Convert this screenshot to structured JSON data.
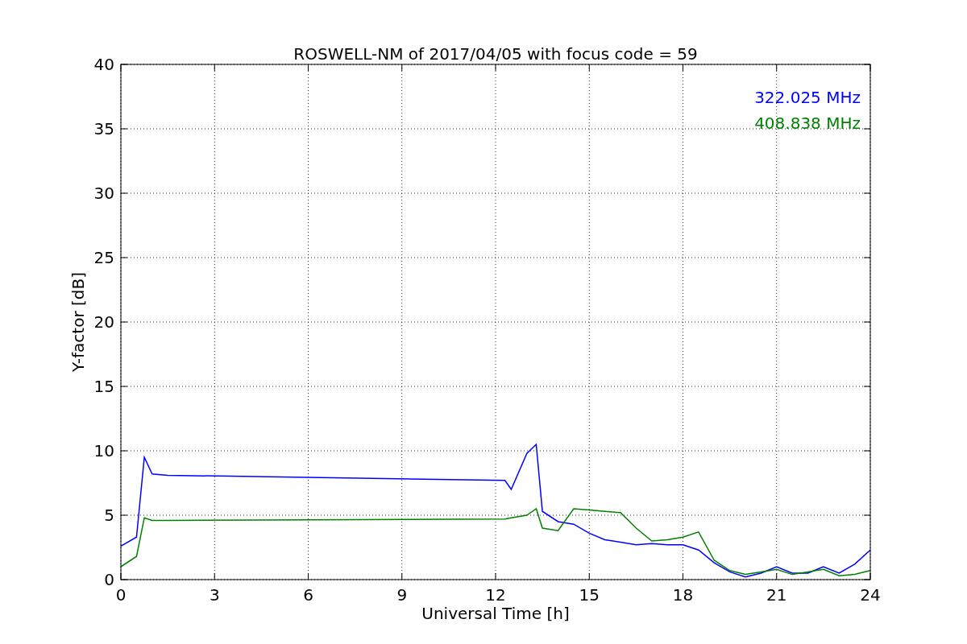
{
  "figure": {
    "chart_data": {
      "type": "line",
      "title": "ROSWELL-NM of 2017/04/05 with focus code = 59",
      "xlabel": "Universal Time [h]",
      "ylabel": "Y-factor [dB]",
      "x": [
        0,
        0.5,
        0.75,
        1,
        1.5,
        12.3,
        12.5,
        13,
        13.3,
        13.5,
        14,
        14.5,
        15,
        15.5,
        16,
        16.5,
        17,
        17.5,
        18,
        18.5,
        19,
        19.5,
        20,
        20.5,
        21,
        21.5,
        22,
        22.5,
        23,
        23.5,
        24
      ],
      "series": [
        {
          "name": "322.025 MHz",
          "color": "#0000ff",
          "values": [
            2.6,
            3.3,
            9.5,
            8.2,
            8.1,
            7.7,
            7.0,
            9.8,
            10.5,
            5.3,
            4.5,
            4.3,
            3.6,
            3.1,
            2.9,
            2.7,
            2.8,
            2.7,
            2.7,
            2.3,
            1.3,
            0.6,
            0.2,
            0.5,
            1.0,
            0.5,
            0.5,
            1.0,
            0.5,
            1.2,
            2.3
          ]
        },
        {
          "name": "408.838 MHz",
          "color": "#008000",
          "values": [
            1.0,
            1.8,
            4.8,
            4.6,
            4.6,
            4.7,
            4.8,
            5.0,
            5.5,
            4.0,
            3.8,
            5.5,
            5.4,
            5.3,
            5.2,
            4.0,
            3.0,
            3.1,
            3.3,
            3.7,
            1.5,
            0.7,
            0.4,
            0.6,
            0.8,
            0.4,
            0.6,
            0.8,
            0.3,
            0.4,
            0.7
          ]
        }
      ],
      "grid": true,
      "xlim": [
        0,
        24
      ],
      "ylim": [
        0,
        40
      ],
      "xticks": [
        0,
        3,
        6,
        9,
        12,
        15,
        18,
        21,
        24
      ],
      "yticks": [
        0,
        5,
        10,
        15,
        20,
        25,
        30,
        35,
        40
      ]
    }
  }
}
